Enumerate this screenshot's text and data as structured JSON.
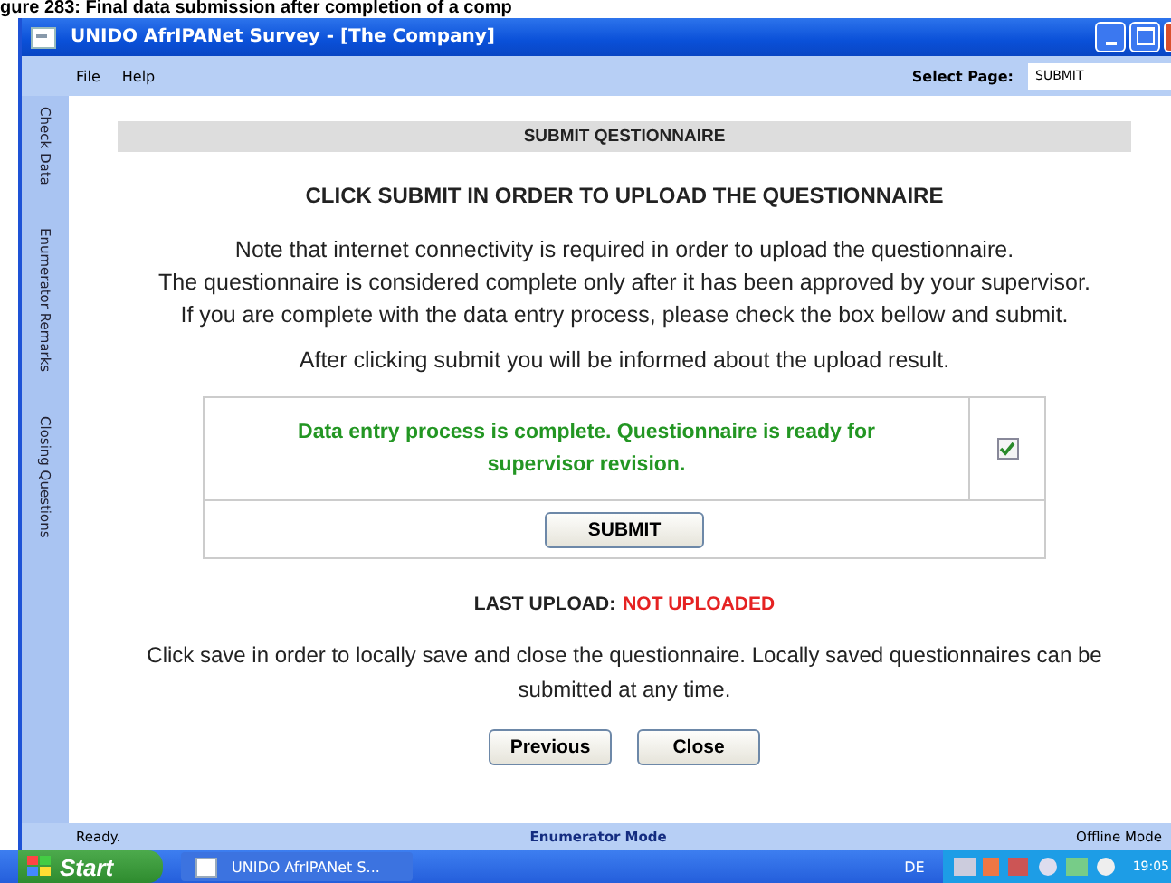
{
  "caption": "gure 283: Final data submission after completion of a comp",
  "window": {
    "title": "UNIDO AfrIPANet Survey - [The Company]"
  },
  "menu": [
    {
      "label": "File"
    },
    {
      "label": "Help"
    }
  ],
  "select_page": {
    "label": "Select Page:",
    "value": "SUBMIT"
  },
  "side_tabs": [
    {
      "label": "Check Data",
      "selected": false
    },
    {
      "label": "Enumerator Remarks",
      "selected": false
    },
    {
      "label": "Closing Questions",
      "selected": false
    }
  ],
  "header": "SUBMIT QESTIONNAIRE",
  "heading": "CLICK SUBMIT IN ORDER TO UPLOAD THE QUESTIONNAIRE",
  "notes": [
    "Note that internet connectivity is required in order to upload the questionnaire.",
    "The questionnaire is considered complete only after it has been approved by your supervisor.",
    "If you are complete with the data entry process, please check the box bellow and submit."
  ],
  "after_note": "After clicking submit you will be informed about the upload result.",
  "confirm": {
    "text": "Data entry process is complete. Questionnaire is ready for supervisor revision.",
    "checked": true
  },
  "submit_button": "SUBMIT",
  "last_upload": {
    "label": "LAST UPLOAD:",
    "value": "NOT UPLOADED"
  },
  "save_note": "Click save in order to locally save and close the questionnaire. Locally saved questionnaires can be submitted at any time.",
  "buttons": [
    "Previous",
    "Close"
  ],
  "status_bar": {
    "left": "Ready.",
    "center": "Enumerator Mode",
    "right": "Offline Mode"
  },
  "taskbar": {
    "start": "Start",
    "tasks": [
      "UNIDO AfrIPANet S..."
    ],
    "language": "DE",
    "clock": "19:05"
  }
}
